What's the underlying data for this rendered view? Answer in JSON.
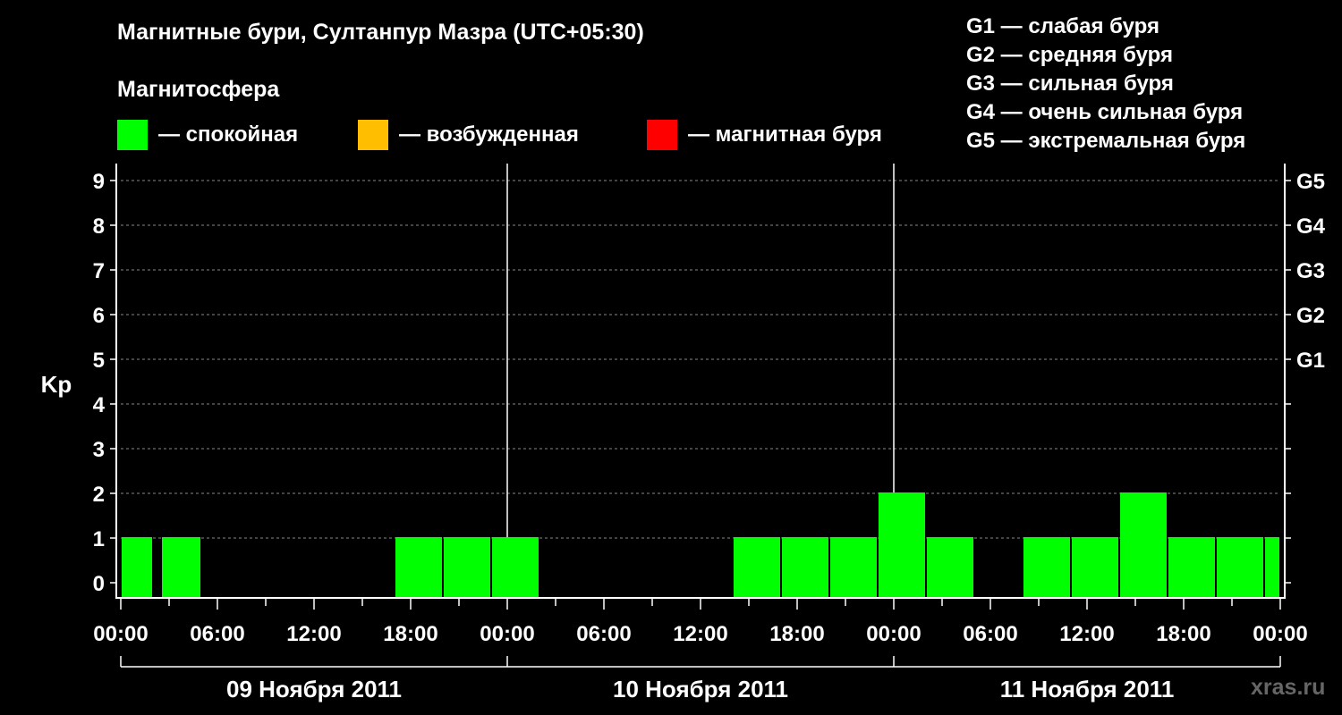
{
  "title": "Магнитные бури, Султанпур Мазра (UTC+05:30)",
  "magnetosphere_title": "Магнитосфера",
  "legend": [
    {
      "label": "— спокойная",
      "color": "#00ff00"
    },
    {
      "label": "— возбужденная",
      "color": "#ffbf00"
    },
    {
      "label": "— магнитная буря",
      "color": "#ff0000"
    }
  ],
  "g_legend": [
    "G1 — слабая буря",
    "G2 — средняя буря",
    "G3 — сильная буря",
    "G4 — очень сильная буря",
    "G5 — экстремальная буря"
  ],
  "watermark": "xras.ru",
  "chart_data": {
    "type": "bar",
    "ylabel": "Kp",
    "ylim": [
      0,
      9
    ],
    "y_ticks": [
      "0",
      "1",
      "2",
      "3",
      "4",
      "5",
      "6",
      "7",
      "8",
      "9"
    ],
    "right_ticks": [
      {
        "kp": 5,
        "label": "G1"
      },
      {
        "kp": 6,
        "label": "G2"
      },
      {
        "kp": 7,
        "label": "G3"
      },
      {
        "kp": 8,
        "label": "G4"
      },
      {
        "kp": 9,
        "label": "G5"
      }
    ],
    "x_tick_labels": [
      "00:00",
      "06:00",
      "12:00",
      "18:00",
      "00:00",
      "06:00",
      "12:00",
      "18:00",
      "00:00",
      "06:00",
      "12:00",
      "18:00",
      "00:00"
    ],
    "days": [
      "09 Ноября 2011",
      "10 Ноября 2011",
      "11 Ноября 2011"
    ],
    "grid": "dashed horizontal",
    "bar_color": "#00ff00",
    "bars": [
      {
        "start": "09 Ноября 2011 00:00",
        "end": "09 Ноября 2011 02:00",
        "kp": 1
      },
      {
        "start": "09 Ноября 2011 02:30",
        "end": "09 Ноября 2011 05:00",
        "kp": 1
      },
      {
        "start": "09 Ноября 2011 17:00",
        "end": "09 Ноября 2011 20:00",
        "kp": 1
      },
      {
        "start": "09 Ноября 2011 20:00",
        "end": "09 Ноября 2011 23:00",
        "kp": 1
      },
      {
        "start": "09 Ноября 2011 23:00",
        "end": "10 Ноября 2011 02:00",
        "kp": 1
      },
      {
        "start": "10 Ноября 2011 14:00",
        "end": "10 Ноября 2011 17:00",
        "kp": 1
      },
      {
        "start": "10 Ноября 2011 17:00",
        "end": "10 Ноября 2011 20:00",
        "kp": 1
      },
      {
        "start": "10 Ноября 2011 20:00",
        "end": "10 Ноября 2011 23:00",
        "kp": 1
      },
      {
        "start": "10 Ноября 2011 23:00",
        "end": "11 Ноября 2011 02:00",
        "kp": 2
      },
      {
        "start": "11 Ноября 2011 02:00",
        "end": "11 Ноября 2011 05:00",
        "kp": 1
      },
      {
        "start": "11 Ноября 2011 08:00",
        "end": "11 Ноября 2011 11:00",
        "kp": 1
      },
      {
        "start": "11 Ноября 2011 11:00",
        "end": "11 Ноября 2011 14:00",
        "kp": 1
      },
      {
        "start": "11 Ноября 2011 14:00",
        "end": "11 Ноября 2011 17:00",
        "kp": 2
      },
      {
        "start": "11 Ноября 2011 17:00",
        "end": "11 Ноября 2011 20:00",
        "kp": 1
      },
      {
        "start": "11 Ноября 2011 20:00",
        "end": "11 Ноября 2011 23:00",
        "kp": 1
      },
      {
        "start": "11 Ноября 2011 23:00",
        "end": "12 Ноября 2011 00:00",
        "kp": 1
      }
    ]
  }
}
